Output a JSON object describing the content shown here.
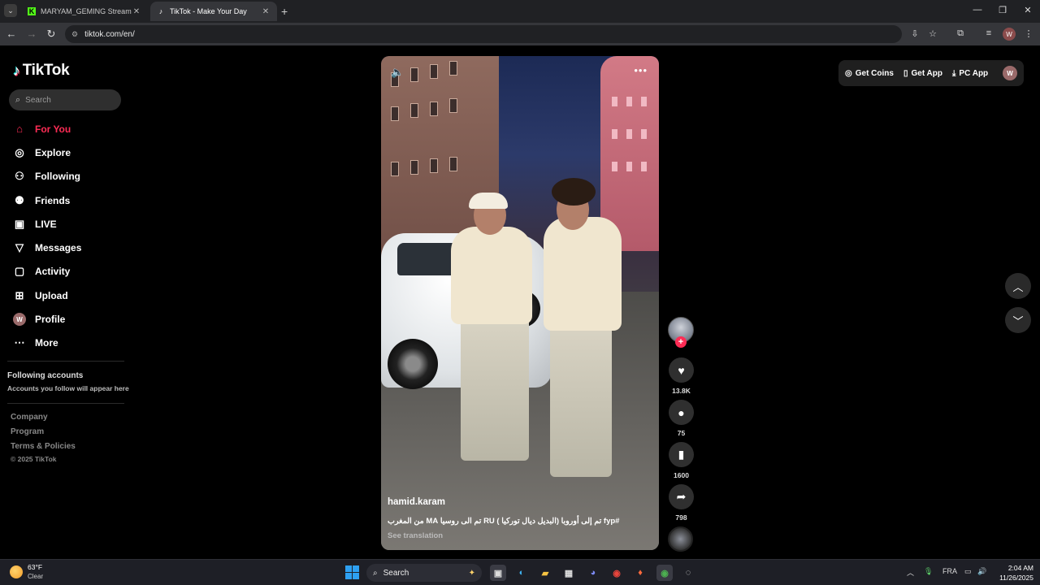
{
  "browser": {
    "tabs": [
      {
        "title": "MARYAM_GEMING Stream - Kic",
        "favicon": "kick-icon",
        "active": false
      },
      {
        "title": "TikTok - Make Your Day",
        "favicon": "tiktok-icon",
        "active": true
      }
    ],
    "url": "tiktok.com/en/"
  },
  "app": {
    "name": "TikTok",
    "search_placeholder": "Search",
    "nav": [
      {
        "label": "For You",
        "icon": "home-icon",
        "active": true
      },
      {
        "label": "Explore",
        "icon": "compass-icon"
      },
      {
        "label": "Following",
        "icon": "following-icon"
      },
      {
        "label": "Friends",
        "icon": "friends-icon"
      },
      {
        "label": "LIVE",
        "icon": "live-icon"
      },
      {
        "label": "Messages",
        "icon": "messages-icon"
      },
      {
        "label": "Activity",
        "icon": "activity-icon"
      },
      {
        "label": "Upload",
        "icon": "upload-icon"
      },
      {
        "label": "Profile",
        "icon": "avatar",
        "avatar_letter": "W"
      },
      {
        "label": "More",
        "icon": "more-icon"
      }
    ],
    "following_accounts": {
      "title": "Following accounts",
      "subtitle": "Accounts you follow will appear here"
    },
    "footer": {
      "links": [
        "Company",
        "Program",
        "Terms & Policies"
      ],
      "copyright": "© 2025 TikTok"
    }
  },
  "topbar": {
    "get_coins": "Get Coins",
    "get_app": "Get App",
    "pc_app": "PC App",
    "avatar_letter": "W"
  },
  "video": {
    "author": "hamid.karam",
    "caption": "#fyp تم إلى أوروبا (البديل ديال توركيا ) RU تم الى روسيا MA من المغرب",
    "see_translation": "See translation"
  },
  "actions": {
    "likes": "13.8K",
    "comments": "75",
    "saves": "1600",
    "shares": "798"
  },
  "taskbar": {
    "weather_temp": "63°F",
    "weather_cond": "Clear",
    "search_label": "Search",
    "language": "FRA",
    "time": "2:04 AM",
    "date": "11/26/2025"
  },
  "colors": {
    "accent": "#fe2c55",
    "background": "#000000"
  }
}
